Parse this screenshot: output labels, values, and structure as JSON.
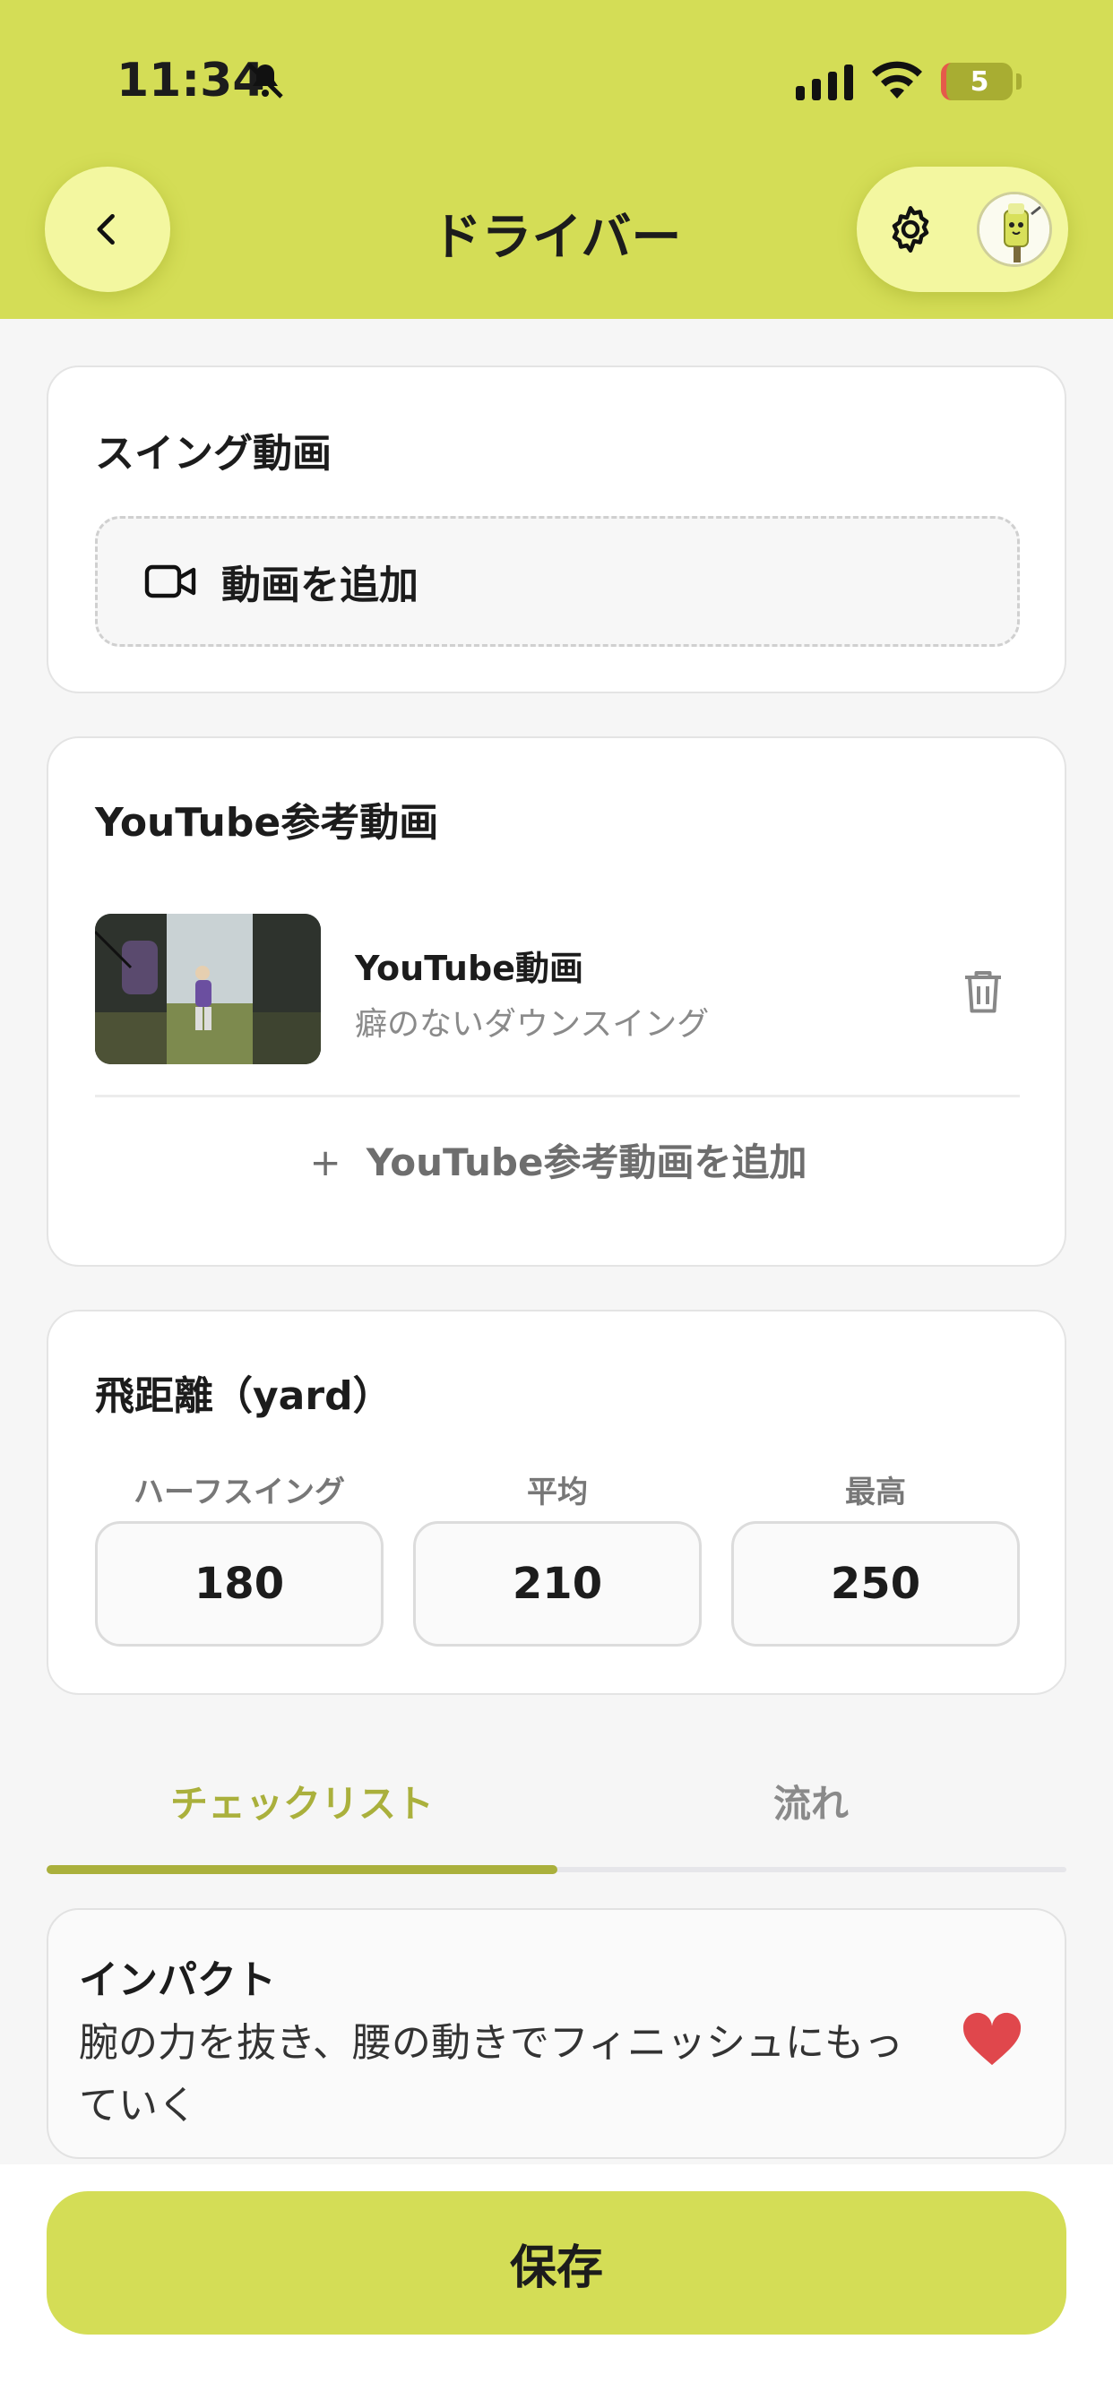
{
  "status_bar": {
    "time": "11:34",
    "battery": "5"
  },
  "header": {
    "title": "ドライバー"
  },
  "swing_video": {
    "title": "スイング動画",
    "add_label": "動画を追加"
  },
  "youtube": {
    "title": "YouTube参考動画",
    "items": [
      {
        "title": "YouTube動画",
        "subtitle": "癖のないダウンスイング"
      }
    ],
    "add_label": "YouTube参考動画を追加",
    "add_prefix": "+"
  },
  "distance": {
    "title": "飛距離（yard）",
    "fields": [
      {
        "label": "ハーフスイング",
        "value": "180"
      },
      {
        "label": "平均",
        "value": "210"
      },
      {
        "label": "最高",
        "value": "250"
      }
    ]
  },
  "tabs": [
    {
      "label": "チェックリスト",
      "active": true
    },
    {
      "label": "流れ",
      "active": false
    }
  ],
  "checklist": [
    {
      "title": "インパクト",
      "text": "腕の力を抜き、腰の動きでフィニッシュにもっていく",
      "favorite": true
    }
  ],
  "footer": {
    "save_label": "保存"
  },
  "colors": {
    "accent": "#d4dd56",
    "accent_light": "#f3f7a0",
    "tab_active": "#aab03c",
    "heart": "#e0474c"
  }
}
